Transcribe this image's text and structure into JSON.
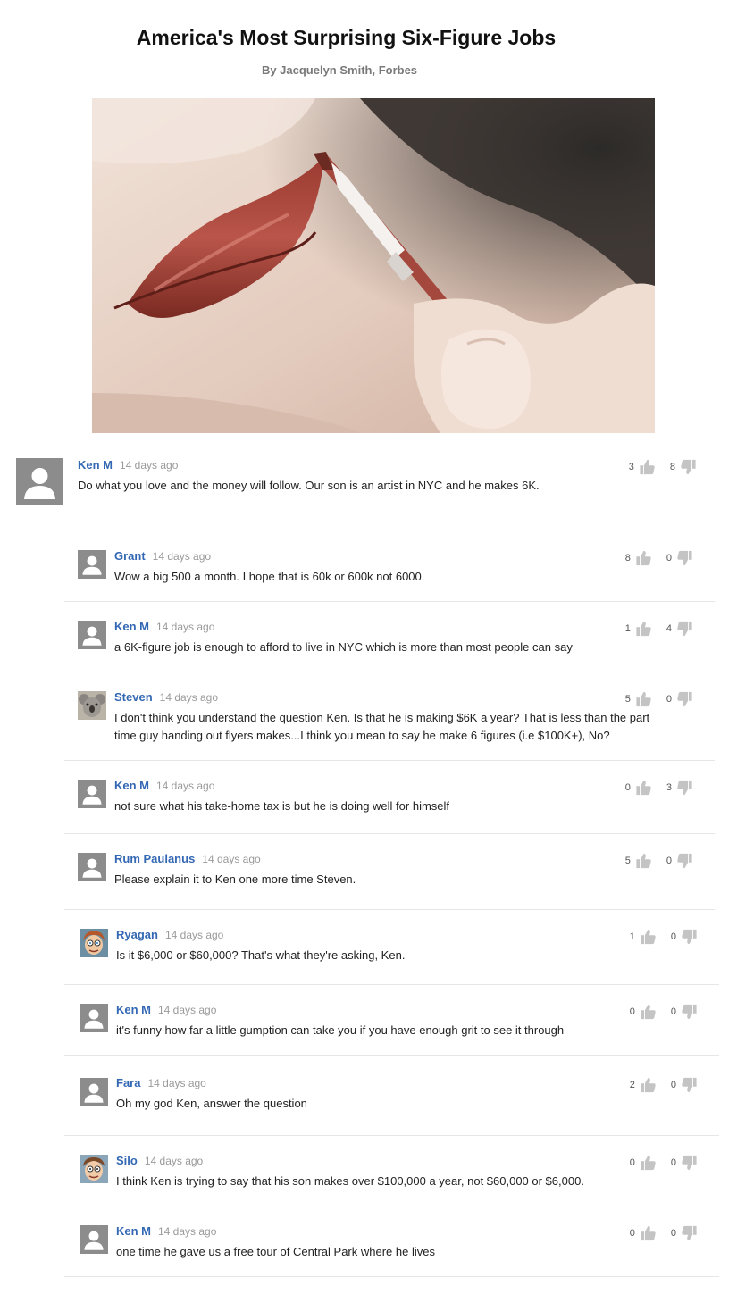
{
  "article": {
    "title": "America's Most Surprising Six-Figure Jobs",
    "byline": "By Jacquelyn Smith, Forbes"
  },
  "comments": [
    {
      "name": "Ken M",
      "time": "14 days ago",
      "text": "Do what you love and the money will follow. Our son is an artist in NYC and he makes 6K.",
      "up": "3",
      "down": "8"
    },
    {
      "name": "Grant",
      "time": "14 days ago",
      "text": "Wow a big 500 a month. I hope that is 60k or 600k not 6000.",
      "up": "8",
      "down": "0"
    },
    {
      "name": "Ken M",
      "time": "14 days ago",
      "text": "a 6K-figure job is enough to afford to live in NYC which is more than most people can say",
      "up": "1",
      "down": "4"
    },
    {
      "name": "Steven",
      "time": "14 days ago",
      "text": "I don't think you understand the question Ken. Is that he is making $6K a year? That is less than the part time guy handing out flyers makes...I think you mean to say he make 6 figures (i.e $100K+), No?",
      "up": "5",
      "down": "0"
    },
    {
      "name": "Ken M",
      "time": "14 days ago",
      "text": "not sure what his take-home tax is but he is doing well for himself",
      "up": "0",
      "down": "3"
    },
    {
      "name": "Rum Paulanus",
      "time": "14 days ago",
      "text": "Please explain it to Ken one more time Steven.",
      "up": "5",
      "down": "0"
    },
    {
      "name": "Ryagan",
      "time": "14 days ago",
      "text": "Is it $6,000 or $60,000? That's what they're asking, Ken.",
      "up": "1",
      "down": "0"
    },
    {
      "name": "Ken M",
      "time": "14 days ago",
      "text": "it's funny how far a little gumption can take you if you have enough grit to see it through",
      "up": "0",
      "down": "0"
    },
    {
      "name": "Fara",
      "time": "14 days ago",
      "text": "Oh my god Ken, answer the question",
      "up": "2",
      "down": "0"
    },
    {
      "name": "Silo",
      "time": "14 days ago",
      "text": "I think Ken is trying to say that his son makes over $100,000 a year, not $60,000 or $6,000.",
      "up": "0",
      "down": "0"
    },
    {
      "name": "Ken M",
      "time": "14 days ago",
      "text": "one time he gave us a free tour of Central Park where he lives",
      "up": "0",
      "down": "0"
    }
  ],
  "icons": {
    "thumbs_up": "thumbs-up-icon",
    "thumbs_down": "thumbs-down-icon",
    "default_avatar": "user-silhouette-icon"
  },
  "colors": {
    "name_link": "#3468b4",
    "timestamp": "#9a9a9a",
    "vote_icon": "#c4c4c4",
    "divider": "#e6e6e6"
  }
}
